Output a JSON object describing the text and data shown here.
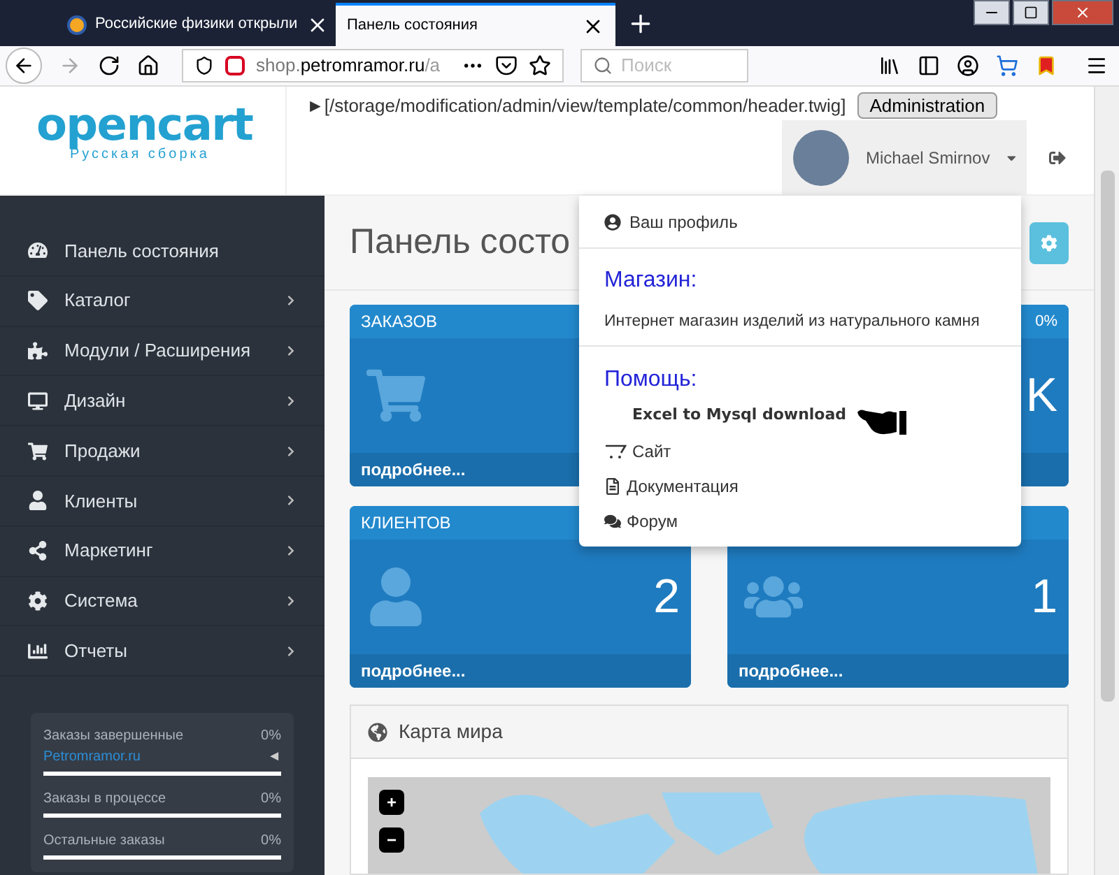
{
  "browser": {
    "tabs": [
      {
        "title": "Российские физики открыли",
        "selected": false
      },
      {
        "title": "Панель состояния",
        "selected": true
      }
    ],
    "url_host": "shop.",
    "url_domain": "petromramor.ru",
    "url_path": "/a",
    "search": {
      "placeholder": "Поиск"
    },
    "forward_disabled": true
  },
  "header": {
    "logo": {
      "name": "opencart",
      "subtitle": "Русская сборка"
    },
    "template_path": "►[/storage/modification/admin/view/template/common/header.twig]",
    "admin_button": "Administration",
    "user": "Michael Smirnov"
  },
  "sidebar": {
    "items": [
      {
        "label": "Панель состояния",
        "expandable": false
      },
      {
        "label": "Каталог",
        "expandable": true
      },
      {
        "label": "Модули / Расширения",
        "expandable": true
      },
      {
        "label": "Дизайн",
        "expandable": true
      },
      {
        "label": "Продажи",
        "expandable": true
      },
      {
        "label": "Клиенты",
        "expandable": true
      },
      {
        "label": "Маркетинг",
        "expandable": true
      },
      {
        "label": "Система",
        "expandable": true
      },
      {
        "label": "Отчеты",
        "expandable": true
      }
    ],
    "stats": [
      {
        "label": "Заказы завершенные",
        "percent": "0%",
        "link": "Petromramor.ru",
        "link_marker": "◄",
        "level": 0
      },
      {
        "label": "Заказы в процессе",
        "percent": "0%",
        "level": 0
      },
      {
        "label": "Остальные заказы",
        "percent": "0%",
        "level": 0
      }
    ]
  },
  "page": {
    "title": "Панель состо",
    "tiles": [
      {
        "title": "ЗАКАЗОВ",
        "footer": "подробнее..."
      },
      {
        "percent": "0%",
        "value": "K"
      },
      {
        "title": "КЛИЕНТОВ",
        "value": "2",
        "footer": "подробнее..."
      },
      {
        "value": "1",
        "footer": "подробнее..."
      }
    ],
    "map": {
      "title": "Карта мира",
      "zoom_in": "+",
      "zoom_out": "−"
    }
  },
  "dropdown": {
    "profile": "Ваш профиль",
    "store_heading": "Магазин:",
    "store_name": "Интернет магазин изделий из натурального камня",
    "help_heading": "Помощь:",
    "help_note": "Excel to Mysql download",
    "links": [
      "Сайт",
      "Документация",
      "Форум"
    ]
  }
}
